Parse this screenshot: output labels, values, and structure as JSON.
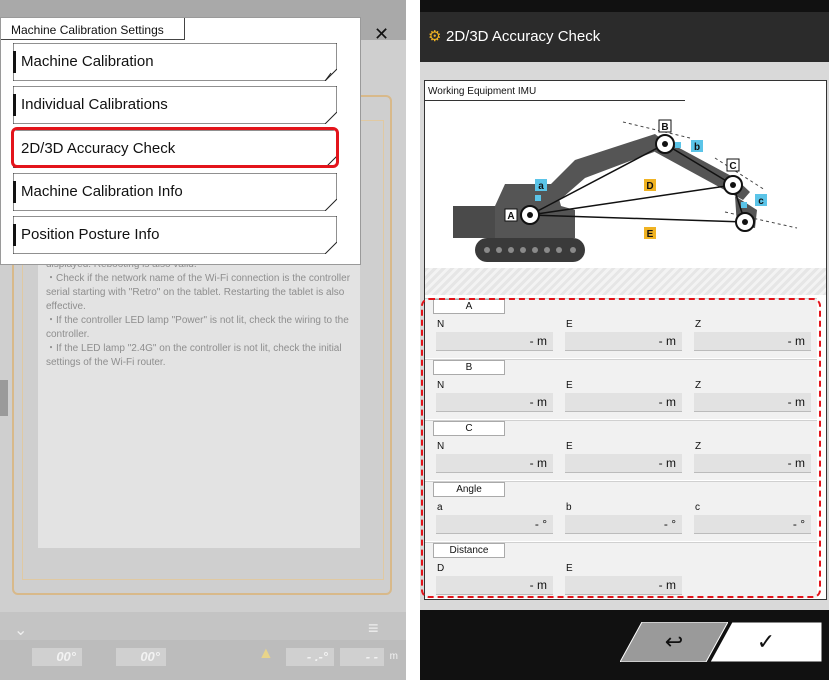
{
  "left": {
    "background_text": " displayed. Rebooting is also valid.\n・Check if the network name of the Wi-Fi connection is the controller serial starting with \"Retro\" on the tablet. Restarting the tablet is also effective.\n・If the controller LED lamp \"Power\" is not lit, check the wiring to the controller.\n・If the LED lamp \"2.4G\" on the controller is not lit, check the initial settings of the Wi-Fi router.",
    "readouts": [
      "00°",
      "00°",
      "- .-°",
      "- -"
    ],
    "readout_unit": "m",
    "popup": {
      "title": "Machine Calibration Settings",
      "close_glyph": "✕",
      "items": [
        {
          "label": "Machine Calibration",
          "selected": false
        },
        {
          "label": "Individual Calibrations",
          "selected": false
        },
        {
          "label": "2D/3D Accuracy Check",
          "selected": true
        },
        {
          "label": "Machine Calibration Info",
          "selected": false
        },
        {
          "label": "Position Posture Info",
          "selected": false
        }
      ]
    }
  },
  "right": {
    "title": "2D/3D Accuracy Check",
    "diagram_title": "Working Equipment IMU",
    "diagram_labels": {
      "A": "A",
      "B": "B",
      "C": "C",
      "a": "a",
      "b": "b",
      "c": "c",
      "D": "D",
      "E": "E"
    },
    "sections": [
      {
        "label": "A",
        "fields": [
          {
            "name": "N",
            "value": "- m"
          },
          {
            "name": "E",
            "value": "- m"
          },
          {
            "name": "Z",
            "value": "- m"
          }
        ]
      },
      {
        "label": "B",
        "fields": [
          {
            "name": "N",
            "value": "- m"
          },
          {
            "name": "E",
            "value": "- m"
          },
          {
            "name": "Z",
            "value": "- m"
          }
        ]
      },
      {
        "label": "C",
        "fields": [
          {
            "name": "N",
            "value": "- m"
          },
          {
            "name": "E",
            "value": "- m"
          },
          {
            "name": "Z",
            "value": "- m"
          }
        ]
      },
      {
        "label": "Angle",
        "fields": [
          {
            "name": "a",
            "value": "- °"
          },
          {
            "name": "b",
            "value": "- °"
          },
          {
            "name": "c",
            "value": "- °"
          }
        ]
      },
      {
        "label": "Distance",
        "fields": [
          {
            "name": "D",
            "value": "- m"
          },
          {
            "name": "E",
            "value": "- m"
          }
        ]
      }
    ],
    "footer": {
      "back_glyph": "↩",
      "confirm_glyph": "✓"
    }
  },
  "colors": {
    "highlight": "#e3141b",
    "accent_yellow": "#f0b323",
    "accent_blue": "#5bc4e8",
    "header": "#2b2b2b"
  }
}
